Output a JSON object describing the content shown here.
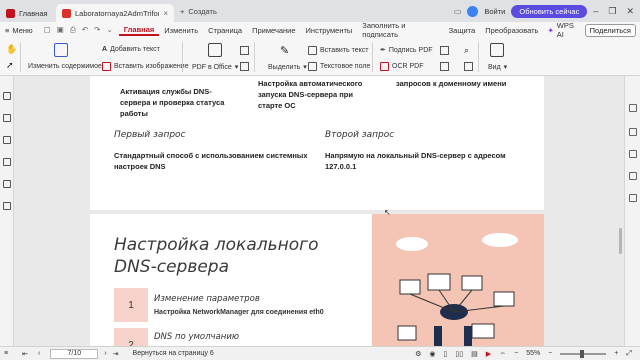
{
  "titlebar": {
    "tabs": [
      {
        "label": "Главная"
      },
      {
        "label": "Laboratornaya2AdmTrifonov"
      }
    ],
    "new_tab_label": "Создать",
    "login_label": "Войти",
    "update_label": "Обновить сейчас"
  },
  "menu": {
    "file_label": "Меню",
    "items": [
      "Главная",
      "Изменить",
      "Страница",
      "Примечание",
      "Инструменты",
      "Заполнить и подписать",
      "Защита",
      "Преобразовать"
    ],
    "wps_ai": "WPS AI",
    "share": "Поделиться"
  },
  "toolbar": {
    "edit_content": "Изменить содержимое",
    "add_text": "Добавить текст",
    "insert_image": "Вставить изображение",
    "pdf_to_office": "PDF в Office",
    "select": "Выделить",
    "insert_text": "Вставить текст",
    "text_field": "Текстовое поле",
    "sign_pdf": "Подпись PDF",
    "ocr_pdf": "OCR PDF",
    "view": "Вид"
  },
  "page1": {
    "left_text_lines": [
      "Активация службы DNS-",
      "сервера и проверка статуса",
      "работы"
    ],
    "mid_text_lines": [
      "Настройка автоматического",
      "запуска DNS-сервера при",
      "старте ОС"
    ],
    "right_text": "запросов к доменному имени",
    "first_request_heading": "Первый запрос",
    "first_request_lines": [
      "Стандартный способ с использованием системных",
      "настроек DNS"
    ],
    "second_request_heading": "Второй запрос",
    "second_request_lines": [
      "Напрямую на локальный DNS-сервер с адресом",
      "127.0.0.1"
    ]
  },
  "page2": {
    "title_lines": [
      "Настройка локального",
      "DNS-сервера"
    ],
    "steps": [
      {
        "num": "1",
        "title": "Изменение параметров",
        "desc": "Настройка NetworkManager для соединения eth0"
      },
      {
        "num": "2",
        "title": "DNS по умолчанию",
        "desc": ""
      }
    ]
  },
  "statusbar": {
    "page_indicator": "7/10",
    "back_label": "Вернуться на страницу 6",
    "zoom": "55%"
  },
  "colors": {
    "accent_red": "#c1121f",
    "update_purple": "#5b4be0",
    "salmon": "#f4c4b4"
  }
}
